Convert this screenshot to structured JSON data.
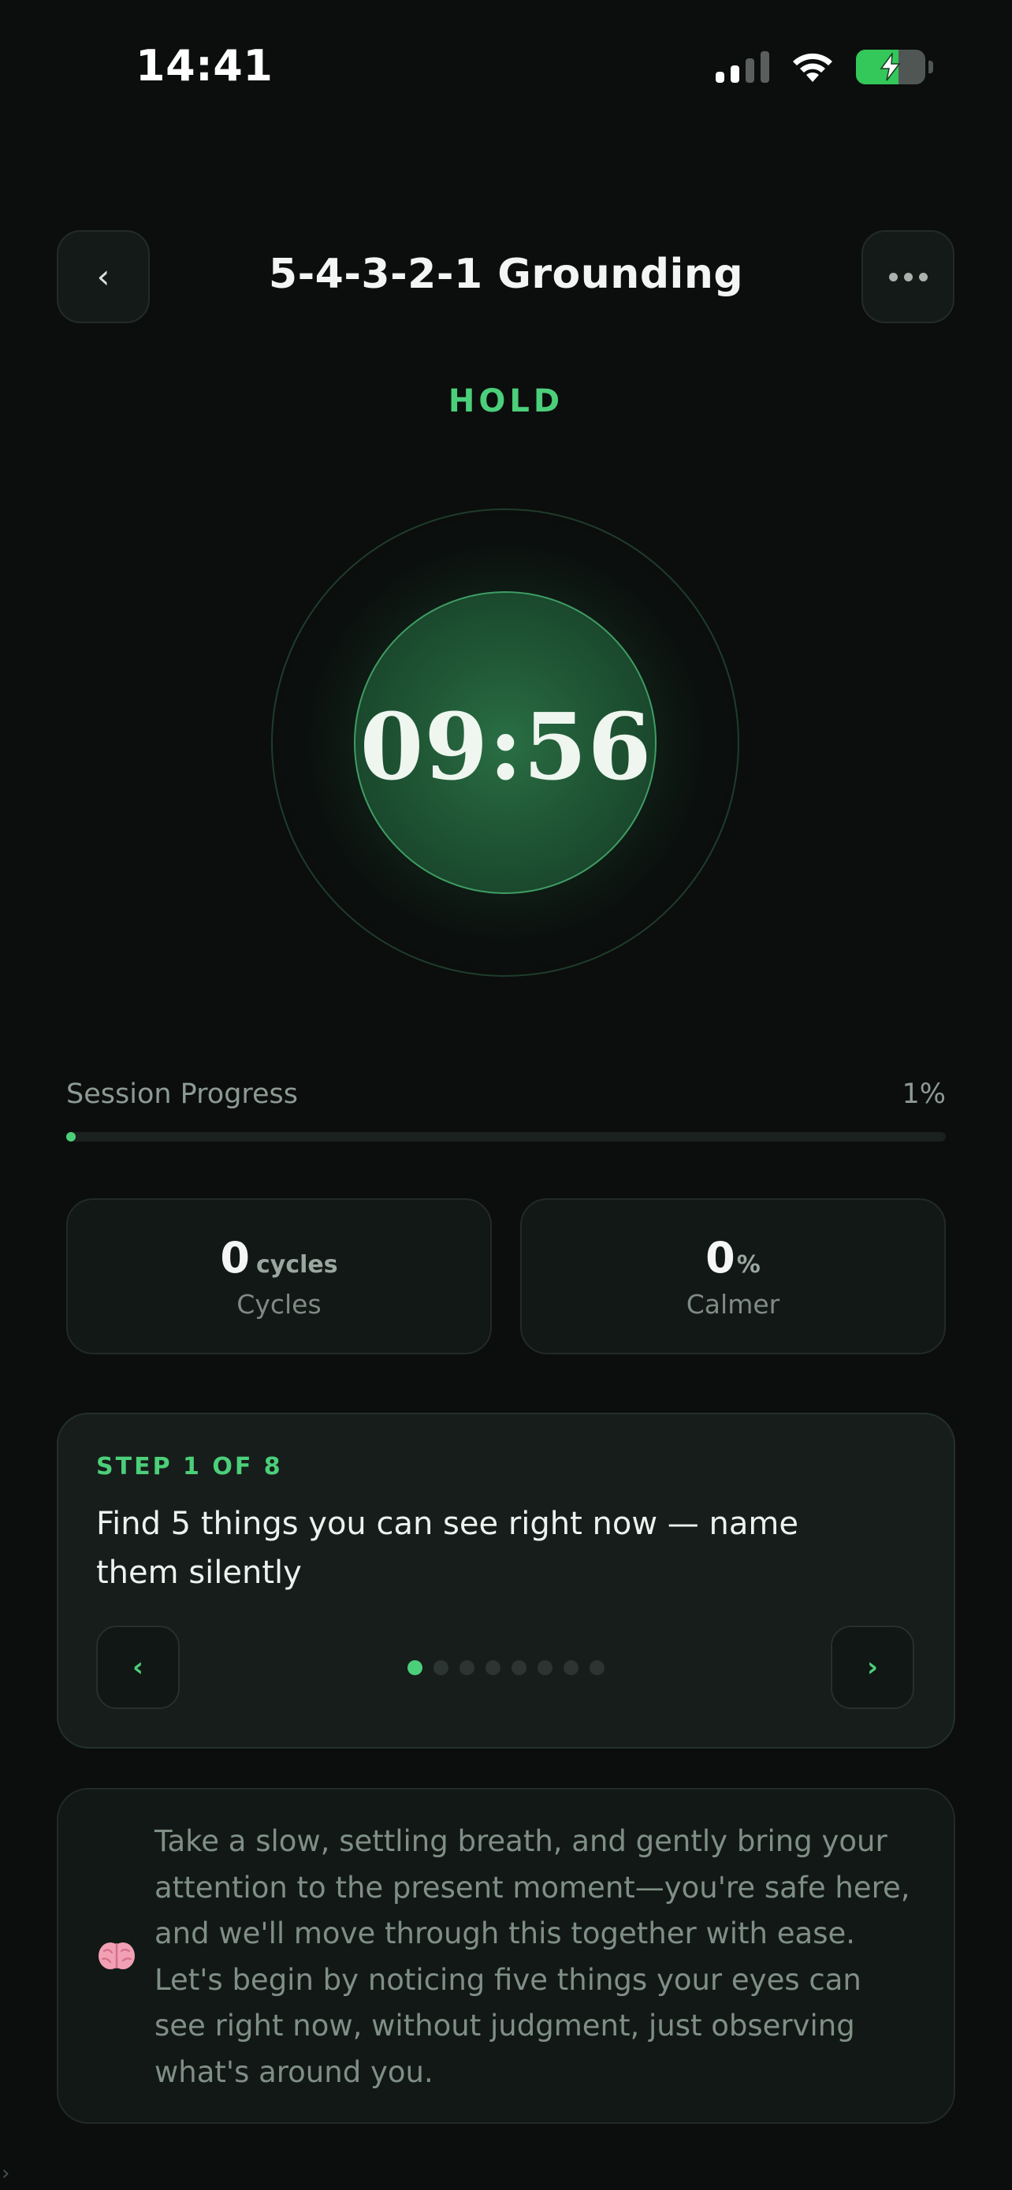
{
  "status_bar": {
    "time": "14:41",
    "icons": [
      "signal-icon",
      "wifi-icon",
      "battery-charging-icon"
    ]
  },
  "header": {
    "title": "5-4-3-2-1 Grounding",
    "back_icon": "chevron-left-icon",
    "more_icon": "more-horizontal-icon"
  },
  "breathing": {
    "phase": "HOLD",
    "timer": "09:56"
  },
  "progress": {
    "label": "Session Progress",
    "percent_text": "1%",
    "percent": 1
  },
  "stats": [
    {
      "value": "0",
      "unit": "cycles",
      "label": "Cycles"
    },
    {
      "value": "0",
      "unit": "%",
      "label": "Calmer"
    }
  ],
  "step": {
    "label": "STEP 1 OF 8",
    "text": "Find 5 things you can see right now — name them silently",
    "prev_icon": "chevron-left-icon",
    "next_icon": "chevron-right-icon",
    "total": 8,
    "current": 1
  },
  "guide": {
    "icon": "brain-icon",
    "text": "Take a slow, settling breath, and gently bring your attention to the present moment—you're safe here, and we'll move through this together with ease. Let's begin by noticing five things your eyes can see right now, without judgment, just observing what's around you."
  },
  "colors": {
    "accent": "#4ccf7a",
    "background": "#0b0e0d",
    "card": "#121816"
  }
}
